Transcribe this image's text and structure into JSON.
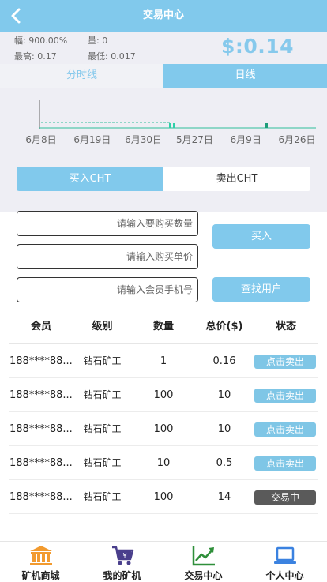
{
  "header": {
    "title": "交易中心"
  },
  "stats": {
    "amplitude": "幅: 900.00%",
    "volume": "量: 0",
    "high": "最高: 0.17",
    "low": "最低: 0.017",
    "price": "$:0.14"
  },
  "chart_tabs": {
    "minute": "分时线",
    "daily": "日线"
  },
  "chart_data": {
    "type": "bar",
    "categories": [
      "6月8日",
      "6月19日",
      "6月30日",
      "5月27日",
      "6月9日",
      "6月26日"
    ],
    "values": [],
    "title": "",
    "xlabel": "",
    "ylabel": "",
    "grid": false
  },
  "trade_toggle": {
    "buy": "买入CHT",
    "sell": "卖出CHT"
  },
  "form": {
    "quantity_placeholder": "请输入要购买数量",
    "price_placeholder": "请输入购买单价",
    "phone_placeholder": "请输入会员手机号",
    "buy_button": "买入",
    "search_button": "查找用户"
  },
  "table": {
    "columns": [
      "会员",
      "级别",
      "数量",
      "总价($)",
      "状态"
    ],
    "rows": [
      {
        "member": "188****88...",
        "level": "钻石矿工",
        "quantity": "1",
        "total": "0.16",
        "status": "点击卖出"
      },
      {
        "member": "188****88...",
        "level": "钻石矿工",
        "quantity": "100",
        "total": "10",
        "status": "点击卖出"
      },
      {
        "member": "188****88...",
        "level": "钻石矿工",
        "quantity": "100",
        "total": "10",
        "status": "点击卖出"
      },
      {
        "member": "188****88...",
        "level": "钻石矿工",
        "quantity": "10",
        "total": "0.5",
        "status": "点击卖出"
      },
      {
        "member": "188****88...",
        "level": "钻石矿工",
        "quantity": "100",
        "total": "14",
        "status": "交易中"
      }
    ]
  },
  "bottom_nav": [
    {
      "label": "矿机商城",
      "icon": "bank-icon",
      "color": "#f29a2e"
    },
    {
      "label": "我的矿机",
      "icon": "cart-icon",
      "color": "#4a3f8c"
    },
    {
      "label": "交易中心",
      "icon": "trend-chart-icon",
      "color": "#2f8f3a"
    },
    {
      "label": "个人中心",
      "icon": "laptop-icon",
      "color": "#3b82e0"
    }
  ],
  "colors": {
    "accent": "#81c9ec",
    "status_sell": "#7fc6e6",
    "status_trading": "#5a5a5a",
    "chart_line": "#2fbf9a"
  }
}
